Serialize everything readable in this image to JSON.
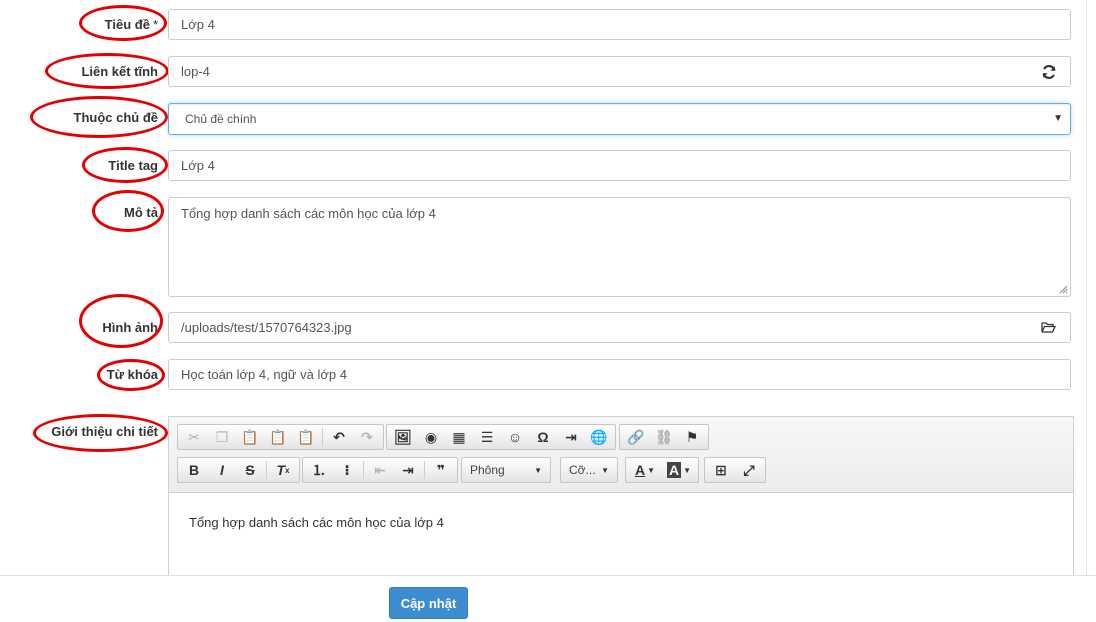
{
  "form": {
    "title": {
      "label": "Tiêu đề",
      "required_mark": "*",
      "value": "Lớp 4"
    },
    "slug": {
      "label": "Liên kết tĩnh",
      "value": "lop-4",
      "refresh_icon": "refresh-icon"
    },
    "category": {
      "label": "Thuộc chủ đề",
      "selected": "Chủ đề chính"
    },
    "title_tag": {
      "label": "Title tag",
      "value": "Lớp 4"
    },
    "description": {
      "label": "Mô tả",
      "value": "Tổng hợp danh sách các môn học của lớp 4"
    },
    "image": {
      "label": "Hình ảnh",
      "value": "/uploads/test/1570764323.jpg",
      "browse_icon": "folder-open-icon"
    },
    "keywords": {
      "label": "Từ khóa",
      "value": "Học toán lớp 4, ngữ và lớp 4"
    },
    "intro": {
      "label": "Giới thiệu chi tiết",
      "content": "Tổng hợp danh sách các môn học của lớp 4",
      "font_combo": "Phông",
      "size_combo": "Cỡ..."
    }
  },
  "footer": {
    "submit_label": "Cập nhật"
  },
  "colors": {
    "annotation": "#e50000",
    "primary": "#3c8dd0",
    "focus": "#66afe9"
  }
}
